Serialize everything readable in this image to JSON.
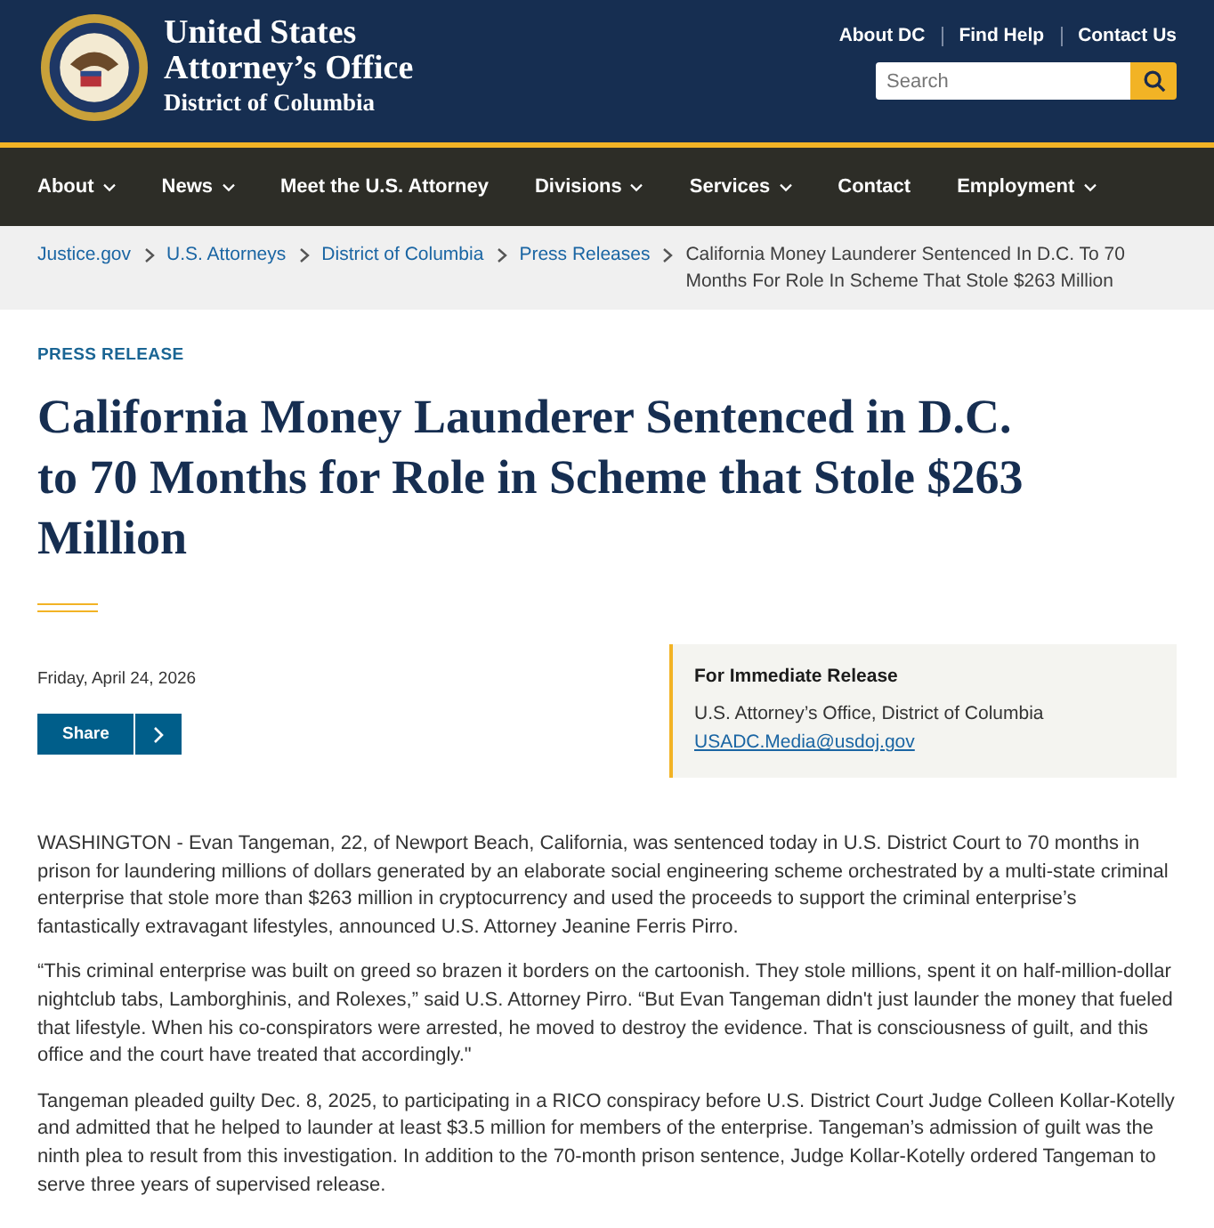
{
  "header": {
    "title_line_1": "United States",
    "title_line_2": "Attorney’s Office",
    "subtitle": "District of Columbia",
    "utility_links": [
      "About DC",
      "Find Help",
      "Contact Us"
    ],
    "search": {
      "placeholder": "Search"
    }
  },
  "nav": [
    {
      "label": "About",
      "has_menu": true
    },
    {
      "label": "News",
      "has_menu": true
    },
    {
      "label": "Meet the U.S. Attorney",
      "has_menu": false
    },
    {
      "label": "Divisions",
      "has_menu": true
    },
    {
      "label": "Services",
      "has_menu": true
    },
    {
      "label": "Contact",
      "has_menu": false
    },
    {
      "label": "Employment",
      "has_menu": true
    }
  ],
  "breadcrumbs": {
    "links": [
      "Justice.gov",
      "U.S. Attorneys",
      "District of Columbia",
      "Press Releases"
    ],
    "current": "California Money Launderer Sentenced In D.C. To 70 Months For Role In Scheme That Stole $263 Million"
  },
  "article": {
    "eyebrow": "PRESS RELEASE",
    "title": "California Money Launderer Sentenced in D.C. to 70 Months for Role in Scheme that Stole $263 Million",
    "date": "Friday, April 24, 2026",
    "share_button": "Share",
    "release_box": {
      "heading": "For Immediate Release",
      "office": "U.S. Attorney’s Office, District of Columbia",
      "email": "USADC.Media@usdoj.gov"
    },
    "paragraphs": [
      "WASHINGTON - Evan Tangeman, 22, of Newport Beach, California, was sentenced today in U.S. District Court to 70 months in prison for laundering millions of dollars generated by an elaborate social engineering scheme orchestrated by a multi-state criminal enterprise that stole more than $263 million in cryptocurrency and used the proceeds to support the criminal enterprise’s fantastically extravagant lifestyles, announced U.S. Attorney Jeanine Ferris Pirro.",
      "“This criminal enterprise was built on greed so brazen it borders on the cartoonish. They stole millions, spent it on half-million-dollar nightclub tabs, Lamborghinis, and Rolexes,” said U.S. Attorney Pirro. “But Evan Tangeman didn't just launder the money that fueled that lifestyle. When his co-conspirators were arrested, he moved to destroy the evidence. That is consciousness of guilt, and this office and the court have treated that accordingly.\"",
      "Tangeman pleaded guilty Dec. 8, 2025, to participating in a RICO conspiracy before U.S. District Court Judge Colleen Kollar-Kotelly and admitted that he helped to launder at least $3.5 million for members of the enterprise. Tangeman’s admission of guilt was the ninth plea to result from this investigation. In addition to the 70-month prison sentence, Judge Kollar-Kotelly ordered Tangeman to serve three years of supervised release."
    ]
  }
}
